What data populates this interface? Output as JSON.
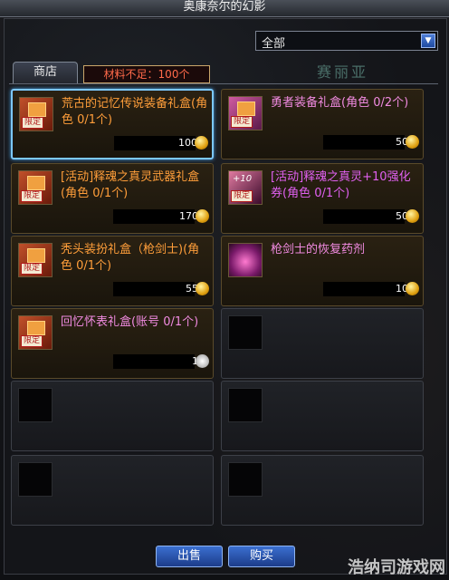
{
  "window": {
    "title": "奥康奈尔的幻影"
  },
  "filter": {
    "selected": "全部",
    "arrow_icon": "chevron-down-icon"
  },
  "background_text": "赛丽亚",
  "tab": {
    "label": "商店"
  },
  "tooltip": {
    "text": "材料不足：100个"
  },
  "items": [
    {
      "name": "荒古的记忆传说装备礼盒(角色 0/1个)",
      "price": "100",
      "badge": "限定",
      "color": "#ff9e3a",
      "currency": "coin-icon"
    },
    {
      "name": "勇者装备礼盒(角色 0/2个)",
      "price": "50",
      "badge": "限定",
      "color": "#f08ae0",
      "currency": "coin-icon"
    },
    {
      "name": "[活动]释魂之真灵武器礼盒(角色 0/1个)",
      "price": "170",
      "badge": "限定",
      "color": "#ff9e3a",
      "currency": "coin-icon"
    },
    {
      "name": "[活动]释魂之真灵+10强化券(角色 0/1个)",
      "price": "50",
      "badge": "限定",
      "icon_text": "+10",
      "color": "#e060f0",
      "currency": "coin-icon"
    },
    {
      "name": "秃头装扮礼盒（枪剑士)(角色 0/1个)",
      "price": "55",
      "badge": "限定",
      "color": "#ff9e3a",
      "currency": "coin-icon"
    },
    {
      "name": "枪剑士的恢复药剂",
      "price": "10",
      "badge": "",
      "color": "#f08ae0",
      "currency": "coin-icon"
    },
    {
      "name": "回忆怀表礼盒(账号 0/1个)",
      "price": "1",
      "badge": "限定",
      "color": "#f08ae0",
      "currency": "clock-icon"
    }
  ],
  "buttons": {
    "sell": "出售",
    "buy": "购买"
  },
  "watermark": "浩纳司游戏网"
}
